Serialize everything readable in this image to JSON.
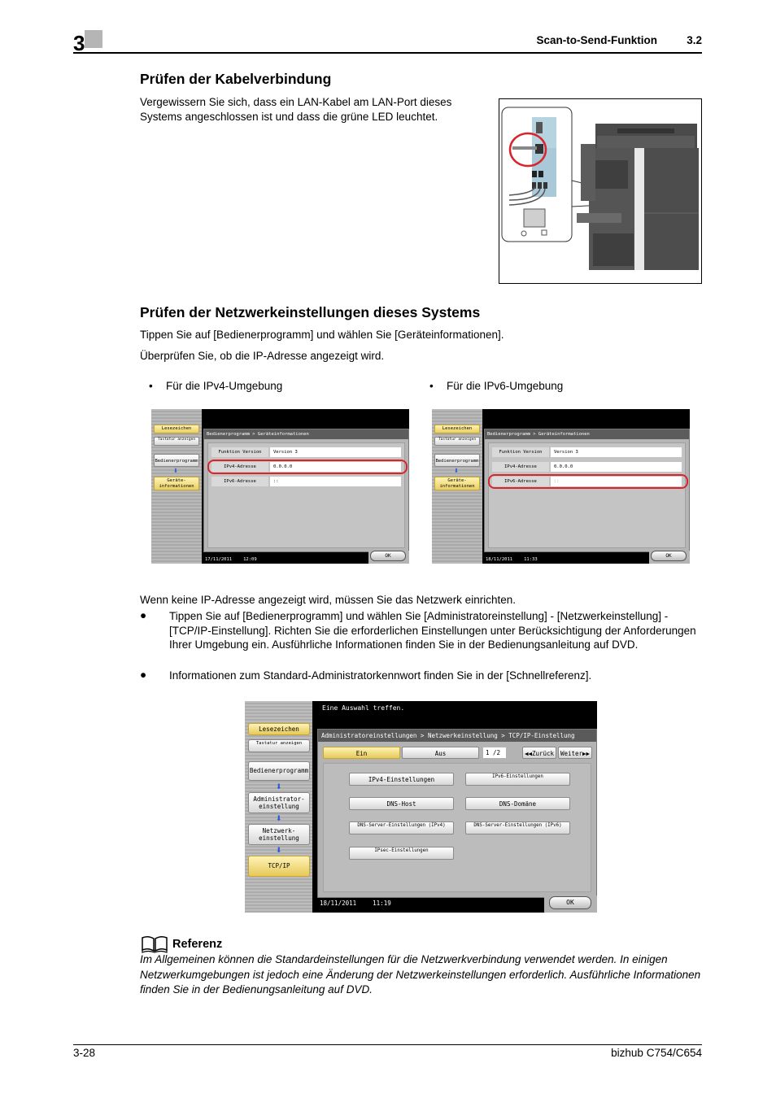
{
  "header": {
    "chapter": "3",
    "title": "Scan-to-Send-Funktion",
    "section": "3.2"
  },
  "section_cable": {
    "heading": "Prüfen der Kabelverbindung",
    "text": "Vergewissern Sie sich, dass ein LAN-Kabel am LAN-Port dieses Systems angeschlossen ist und dass die grüne LED leuchtet.",
    "figure": "printer-lan-port-illustration",
    "highlight_color": "#d9242b"
  },
  "section_network": {
    "heading": "Prüfen der Netzwerkeinstellungen dieses Systems",
    "para1": "Tippen Sie auf [Bedienerprogramm] und wählen Sie [Geräteinformationen].",
    "para2": "Überprüfen Sie, ob die IP-Adresse angezeigt wird.",
    "bullets": [
      "Für die IPv4-Umgebung",
      "Für die IPv6-Umgebung"
    ],
    "bullet_glyph": "•"
  },
  "panel_ipv4": {
    "sidebar": {
      "bookmark": "Lesezeichen",
      "keyboard": "Tastatur anzeigen",
      "utility": "Bedienerprogramm",
      "device_info": "Geräte-informationen"
    },
    "breadcrumb": "Bedienerprogramm > Geräteinformationen",
    "rows": [
      {
        "label": "Funktion Version",
        "value": "Version 3"
      },
      {
        "label": "IPv4-Adresse",
        "value": "0.0.0.0"
      },
      {
        "label": "IPv6-Adresse",
        "value": "::"
      }
    ],
    "highlighted_row": "IPv4-Adresse",
    "date": "17/11/2011",
    "time": "12:09",
    "ok": "OK"
  },
  "panel_ipv6": {
    "sidebar": {
      "bookmark": "Lesezeichen",
      "keyboard": "Tastatur anzeigen",
      "utility": "Bedienerprogramm",
      "device_info": "Geräte-informationen"
    },
    "breadcrumb": "Bedienerprogramm > Geräteinformationen",
    "rows": [
      {
        "label": "Funktion Version",
        "value": "Version 3"
      },
      {
        "label": "IPv4-Adresse",
        "value": "0.0.0.0"
      },
      {
        "label": "IPv6-Adresse",
        "value": "::"
      }
    ],
    "highlighted_row": "IPv6-Adresse",
    "date": "18/11/2011",
    "time": "11:33",
    "ok": "OK"
  },
  "section_setup": {
    "intro": "Wenn keine IP-Adresse angezeigt wird, müssen Sie das Netzwerk einrichten.",
    "items": [
      "Tippen Sie auf [Bedienerprogramm] und wählen Sie [Administratoreinstellung] - [Netzwerkeinstellung] - [TCP/IP-Einstellung]. Richten Sie die erforderlichen Einstellungen unter Berücksichtigung der Anforderungen Ihrer Umgebung ein. Ausführliche Informationen finden Sie in der Bedienungsanleitung auf DVD.",
      "Informationen zum Standard-Administratorkennwort finden Sie in der [Schnellreferenz]."
    ],
    "bullet_glyph": "●"
  },
  "panel_tcpip": {
    "message": "Eine Auswahl treffen.",
    "sidebar": {
      "bookmark": "Lesezeichen",
      "keyboard": "Tastatur anzeigen",
      "utility": "Bedienerprogramm",
      "admin": "Administrator-einstellung",
      "network": "Netzwerk-einstellung",
      "tcpip": "TCP/IP"
    },
    "breadcrumb": "Administratoreinstellungen > Netzwerkeinstellung > TCP/IP-Einstellung",
    "toggle_on": "Ein",
    "toggle_off": "Aus",
    "page": "1 /2",
    "prev": "◀◀Zurück",
    "next": "Weiter▶▶",
    "options": [
      "IPv4-Einstellungen",
      "IPv6-Einstellungen",
      "DNS-Host",
      "DNS-Domäne",
      "DNS-Server-Einstellungen (IPv4)",
      "DNS-Server-Einstellungen (IPv6)",
      "IPsec-Einstellungen"
    ],
    "date": "18/11/2011",
    "time": "11:19",
    "ok": "OK"
  },
  "reference": {
    "icon": "book-icon",
    "title": "Referenz",
    "text": "Im Allgemeinen können die Standardeinstellungen für die Netzwerkverbindung verwendet werden. In einigen Netzwerkumgebungen ist jedoch eine Änderung der Netzwerkeinstellungen erforderlich. Ausführliche Informationen finden Sie in der Bedienungsanleitung auf DVD."
  },
  "footer": {
    "page": "3-28",
    "product": "bizhub C754/C654"
  }
}
